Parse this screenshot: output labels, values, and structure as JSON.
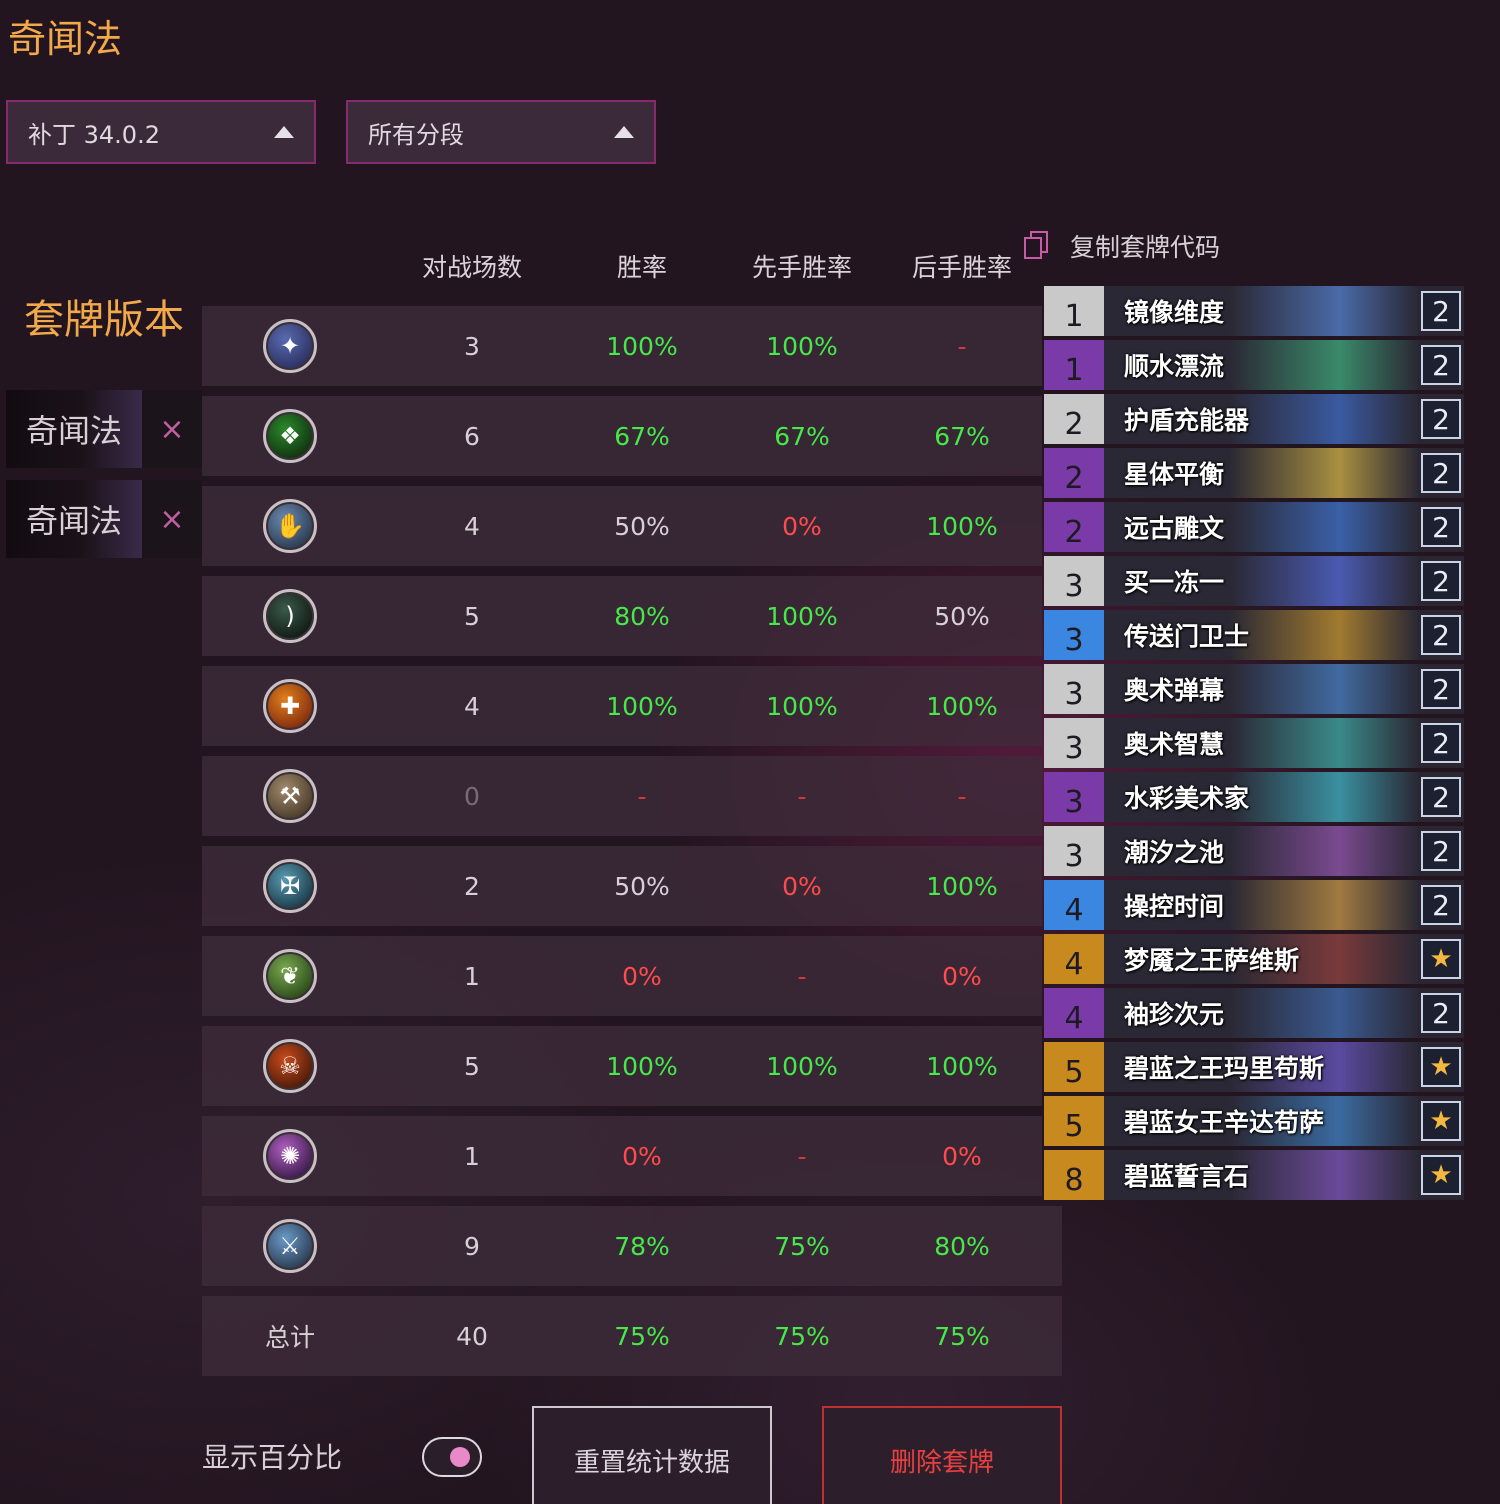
{
  "deck_title": "奇闻法",
  "filters": {
    "patch": "补丁 34.0.2",
    "rank": "所有分段"
  },
  "versions": {
    "title": "套牌版本",
    "items": [
      {
        "name": "奇闻法",
        "close": "×"
      },
      {
        "name": "奇闻法",
        "close": "×"
      }
    ]
  },
  "table": {
    "headers": {
      "games": "对战场数",
      "winrate": "胜率",
      "first": "先手胜率",
      "second": "后手胜率"
    },
    "rows": [
      {
        "icon": "mage-class-icon",
        "games": "3",
        "winrate": "100%",
        "first": "100%",
        "second": "-"
      },
      {
        "icon": "rogue-class-icon",
        "games": "6",
        "winrate": "67%",
        "first": "67%",
        "second": "67%"
      },
      {
        "icon": "shaman-class-icon",
        "games": "4",
        "winrate": "50%",
        "first": "0%",
        "second": "100%"
      },
      {
        "icon": "hunter-class-icon",
        "games": "5",
        "winrate": "80%",
        "first": "100%",
        "second": "50%"
      },
      {
        "icon": "priest-class-icon",
        "games": "4",
        "winrate": "100%",
        "first": "100%",
        "second": "100%"
      },
      {
        "icon": "paladin-class-icon",
        "games": "0",
        "winrate": "-",
        "first": "-",
        "second": "-"
      },
      {
        "icon": "death-knight-class-icon",
        "games": "2",
        "winrate": "50%",
        "first": "0%",
        "second": "100%"
      },
      {
        "icon": "druid-class-icon",
        "games": "1",
        "winrate": "0%",
        "first": "-",
        "second": "0%"
      },
      {
        "icon": "warlock-class-icon",
        "games": "5",
        "winrate": "100%",
        "first": "100%",
        "second": "100%"
      },
      {
        "icon": "demon-hunter-class-icon",
        "games": "1",
        "winrate": "0%",
        "first": "-",
        "second": "0%"
      },
      {
        "icon": "warrior-class-icon",
        "games": "9",
        "winrate": "78%",
        "first": "75%",
        "second": "80%"
      }
    ],
    "total": {
      "label": "总计",
      "games": "40",
      "winrate": "75%",
      "first": "75%",
      "second": "75%"
    }
  },
  "copy_code_label": "复制套牌代码",
  "cards": [
    {
      "cost": "1",
      "name": "镜像维度",
      "count": "2",
      "rarity": "common",
      "art": "#4a6aa8"
    },
    {
      "cost": "1",
      "name": "顺水漂流",
      "count": "2",
      "rarity": "epic",
      "art": "#3a8a6a"
    },
    {
      "cost": "2",
      "name": "护盾充能器",
      "count": "2",
      "rarity": "common",
      "art": "#3a5aa0"
    },
    {
      "cost": "2",
      "name": "星体平衡",
      "count": "2",
      "rarity": "epic",
      "art": "#a89040"
    },
    {
      "cost": "2",
      "name": "远古雕文",
      "count": "2",
      "rarity": "epic",
      "art": "#3a60a8"
    },
    {
      "cost": "3",
      "name": "买一冻一",
      "count": "2",
      "rarity": "common",
      "art": "#4a5ab0"
    },
    {
      "cost": "3",
      "name": "传送门卫士",
      "count": "2",
      "rarity": "rare",
      "art": "#a07a30"
    },
    {
      "cost": "3",
      "name": "奥术弹幕",
      "count": "2",
      "rarity": "common",
      "art": "#406aa0"
    },
    {
      "cost": "3",
      "name": "奥术智慧",
      "count": "2",
      "rarity": "common",
      "art": "#3a8a8a"
    },
    {
      "cost": "3",
      "name": "水彩美术家",
      "count": "2",
      "rarity": "epic",
      "art": "#3a90a0"
    },
    {
      "cost": "3",
      "name": "潮汐之池",
      "count": "2",
      "rarity": "common",
      "art": "#7a4a90"
    },
    {
      "cost": "4",
      "name": "操控时间",
      "count": "2",
      "rarity": "rare",
      "art": "#a07a40"
    },
    {
      "cost": "4",
      "name": "梦魇之王萨维斯",
      "count": "★",
      "rarity": "legendary",
      "art": "#7a3a3a"
    },
    {
      "cost": "4",
      "name": "袖珍次元",
      "count": "2",
      "rarity": "epic",
      "art": "#3a5a90"
    },
    {
      "cost": "5",
      "name": "碧蓝之王玛里苟斯",
      "count": "★",
      "rarity": "legendary",
      "art": "#5a4aa0"
    },
    {
      "cost": "5",
      "name": "碧蓝女王辛达苟萨",
      "count": "★",
      "rarity": "legendary",
      "art": "#3a6aa0"
    },
    {
      "cost": "8",
      "name": "碧蓝誓言石",
      "count": "★",
      "rarity": "legendary",
      "art": "#6a4a9a"
    }
  ],
  "rarity_colors": {
    "common": "#c9c9c9",
    "rare": "#3a86e0",
    "epic": "#7a3aa8",
    "legendary": "#c88a1e"
  },
  "bottom": {
    "show_percent_label": "显示百分比",
    "reset_button": "重置统计数据",
    "delete_button": "删除套牌"
  }
}
